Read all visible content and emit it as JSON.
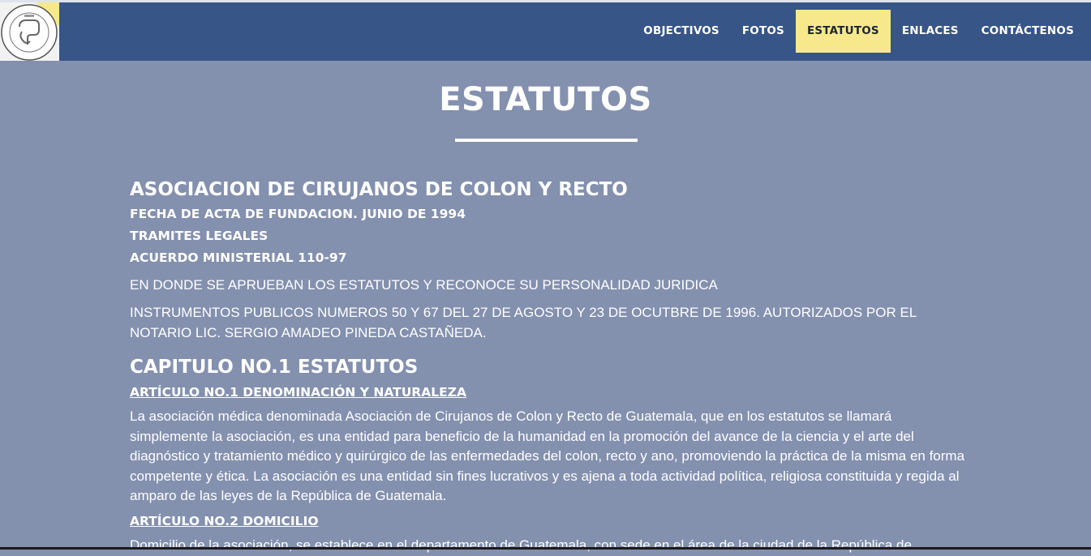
{
  "header": {
    "logo_icon": "association-seal-logo",
    "nav": [
      {
        "label": "OBJECTIVOS",
        "active": false
      },
      {
        "label": "FOTOS",
        "active": false
      },
      {
        "label": "ESTATUTOS",
        "active": true
      },
      {
        "label": "ENLACES",
        "active": false
      },
      {
        "label": "CONTÁCTENOS",
        "active": false
      }
    ]
  },
  "page": {
    "title": "ESTATUTOS"
  },
  "intro": {
    "heading": "ASOCIACION DE CIRUJANOS DE COLON Y RECTO",
    "founding_date": "FECHA DE ACTA DE FUNDACION. JUNIO DE 1994",
    "legal_procedures": "TRAMITES LEGALES",
    "ministerial_agreement": "ACUERDO MINISTERIAL 110-97",
    "approval_text": "EN DONDE SE APRUEBAN LOS ESTATUTOS Y RECONOCE SU PERSONALIDAD JURIDICA",
    "instruments_text": "INSTRUMENTOS PUBLICOS NUMEROS 50 Y 67 DEL 27 DE AGOSTO Y 23 DE OCUTBRE DE 1996. AUTORIZADOS POR EL NOTARIO LIC. SERGIO AMADEO PINEDA CASTAÑEDA."
  },
  "chapter": {
    "heading": "CAPITULO NO.1 ESTATUTOS",
    "articles": [
      {
        "title": "ARTÍCULO NO.1 DENOMINACIÓN Y NATURALEZA",
        "body": "La asociación médica denominada Asociación de Cirujanos de Colon y Recto de Guatemala, que en los estatutos se llamará simplemente la asociación, es una entidad para beneficio de la humanidad en la promoción del avance de la ciencia y el arte del diagnóstico y tratamiento médico y quirúrgico de las enfermedades del colon, recto y ano, promoviendo la práctica de la misma en forma competente y ética. La asociación es una entidad sin fines lucrativos y es ajena a toda actividad política, religiosa constituida y regida al amparo de las leyes de la República de Guatemala."
      },
      {
        "title": "ARTÍCULO NO.2 DOMICILIO",
        "body": "Domicilio de la asociación, se establece en el departamento de Guatemala, con sede en el área de la ciudad de la República de"
      }
    ]
  },
  "colors": {
    "navbar": "#375587",
    "background": "#8390ae",
    "active_tab": "#f7e88c"
  }
}
